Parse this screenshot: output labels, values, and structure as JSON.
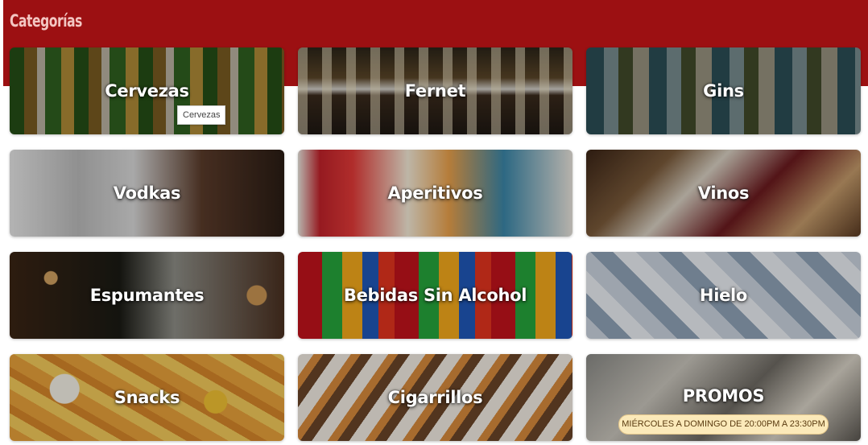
{
  "header": {
    "title": "Categorías"
  },
  "categories": [
    {
      "label": "Cervezas"
    },
    {
      "label": "Fernet"
    },
    {
      "label": "Gins"
    },
    {
      "label": "Vodkas"
    },
    {
      "label": "Aperitivos"
    },
    {
      "label": "Vinos"
    },
    {
      "label": "Espumantes"
    },
    {
      "label": "Bebidas Sin Alcohol"
    },
    {
      "label": "Hielo"
    },
    {
      "label": "Snacks"
    },
    {
      "label": "Cigarrillos"
    },
    {
      "label": "PROMOS",
      "schedule": "MIÉRCOLES A DOMINGO DE 20:00PM A 23:30PM"
    }
  ],
  "tooltip": {
    "text": "Cervezas"
  },
  "colors": {
    "banner": "#9c1012",
    "title": "#f3c6c2",
    "promo_pill": "#fbe9b9"
  }
}
